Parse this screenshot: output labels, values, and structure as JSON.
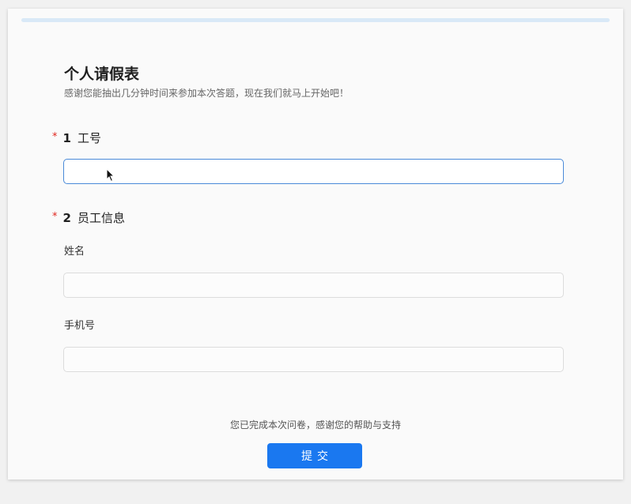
{
  "form": {
    "title": "个人请假表",
    "subtitle": "感谢您能抽出几分钟时间来参加本次答题，现在我们就马上开始吧！"
  },
  "questions": [
    {
      "required_mark": "*",
      "number": "1",
      "label": "工号",
      "value": ""
    },
    {
      "required_mark": "*",
      "number": "2",
      "label": "员工信息",
      "fields": [
        {
          "label": "姓名",
          "value": ""
        },
        {
          "label": "手机号",
          "value": ""
        }
      ]
    }
  ],
  "footer": {
    "text": "您已完成本次问卷，感谢您的帮助与支持",
    "submit_label": "提交"
  },
  "colors": {
    "accent": "#1a78f0",
    "required": "#e0271f",
    "focus_border": "#4a8ad8"
  },
  "icons": {
    "cursor": "mouse-pointer-icon"
  }
}
